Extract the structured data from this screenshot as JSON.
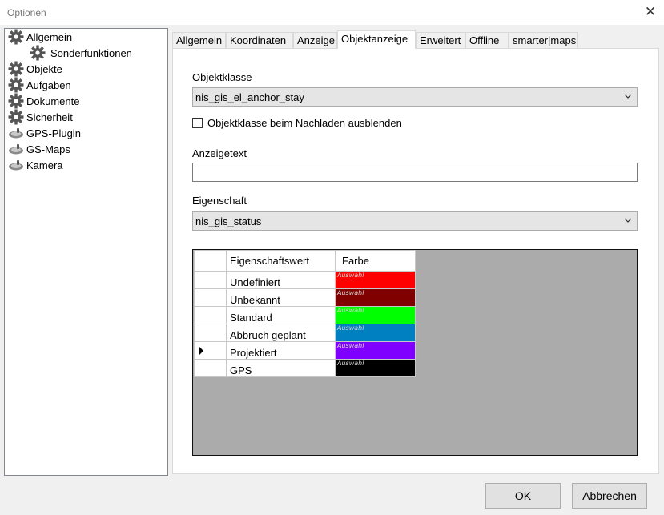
{
  "window": {
    "title": "Optionen",
    "close_glyph": "✕"
  },
  "tree": [
    {
      "label": "Allgemein",
      "icon": "gear-icon"
    },
    {
      "label": "Sonderfunktionen",
      "icon": "gear-icon"
    },
    {
      "label": "Objekte",
      "icon": "gear-icon"
    },
    {
      "label": "Aufgaben",
      "icon": "gear-icon"
    },
    {
      "label": "Dokumente",
      "icon": "gear-icon"
    },
    {
      "label": "Sicherheit",
      "icon": "gear-icon"
    },
    {
      "label": "GPS-Plugin",
      "icon": "gps-device-icon"
    },
    {
      "label": "GS-Maps",
      "icon": "gps-device-icon"
    },
    {
      "label": "Kamera",
      "icon": "gps-device-icon"
    }
  ],
  "tabs": [
    {
      "label": "Allgemein"
    },
    {
      "label": "Koordinaten"
    },
    {
      "label": "Anzeige"
    },
    {
      "label": "Objektanzeige",
      "active": true
    },
    {
      "label": "Erweitert"
    },
    {
      "label": "Offline"
    },
    {
      "label": "smarter|maps"
    }
  ],
  "form": {
    "objektklasse_label": "Objektklasse",
    "objektklasse_value": "nis_gis_el_anchor_stay",
    "hide_checkbox_label": "Objektklasse beim Nachladen ausblenden",
    "hide_checkbox_checked": false,
    "anzeigetext_label": "Anzeigetext",
    "anzeigetext_value": "",
    "eigenschaft_label": "Eigenschaft",
    "eigenschaft_value": "nis_gis_status"
  },
  "grid": {
    "headers": [
      "Eigenschaftswert",
      "Farbe"
    ],
    "rows": [
      {
        "value": "Undefiniert",
        "color_label": "Auswahl",
        "color": "#ff0000",
        "current": false
      },
      {
        "value": "Unbekannt",
        "color_label": "Auswahl",
        "color": "#800000",
        "current": false
      },
      {
        "value": "Standard",
        "color_label": "Auswahl",
        "color": "#00ff00",
        "current": false
      },
      {
        "value": "Abbruch geplant",
        "color_label": "Auswahl",
        "color": "#0080c0",
        "current": false
      },
      {
        "value": "Projektiert",
        "color_label": "Auswahl",
        "color": "#8000ff",
        "current": true
      },
      {
        "value": "GPS",
        "color_label": "Auswahl",
        "color": "#000000",
        "current": false
      }
    ]
  },
  "buttons": {
    "ok": "OK",
    "cancel": "Abbrechen"
  }
}
